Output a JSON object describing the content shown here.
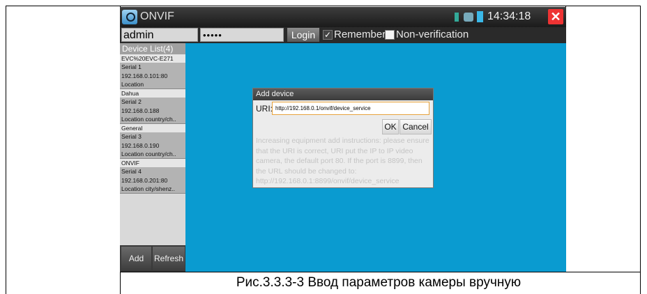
{
  "app": {
    "title": "ONVIF",
    "time": "14:34:18"
  },
  "login": {
    "username": "admin",
    "password_mask": "•••••",
    "login_label": "Login",
    "remember_label": "Remember",
    "remember_checked": true,
    "nonverification_label": "Non-verification",
    "nonverification_checked": false
  },
  "device_list": {
    "header": "Device List(4)",
    "devices": [
      {
        "name": "EVC%20EVC-E271",
        "serial": "Serial 1",
        "address": "192.168.0.101:80",
        "location": "Location"
      },
      {
        "name": "Dahua",
        "serial": "Serial 2",
        "address": "192.168.0.188",
        "location": "Location country/ch.."
      },
      {
        "name": "General",
        "serial": "Serial 3",
        "address": "192.168.0.190",
        "location": "Location country/ch.."
      },
      {
        "name": "ONVIF",
        "serial": "Serial 4",
        "address": "192.168.0.201:80",
        "location": "Location city/shenz.."
      }
    ],
    "add_label": "Add",
    "refresh_label": "Refresh"
  },
  "dialog": {
    "title": "Add device",
    "uri_label": "URI:",
    "uri_value": "http://192.168.0.1/onvif/device_service",
    "ok_label": "OK",
    "cancel_label": "Cancel",
    "help_text": "Increasing equipment add instructions: please ensure that the URI is correct, URI put the IP to IP video camera, the default port 80. If the port is 8899, then the URL should be changed to: http://192.168.0.1:8899/onvif/device_service"
  },
  "caption": "Рис.3.3.3-3  Ввод параметров камеры вручную",
  "colors": {
    "screen_bg": "#0a9bd0",
    "close_red": "#e33333",
    "input_focus": "#e8a33c"
  }
}
